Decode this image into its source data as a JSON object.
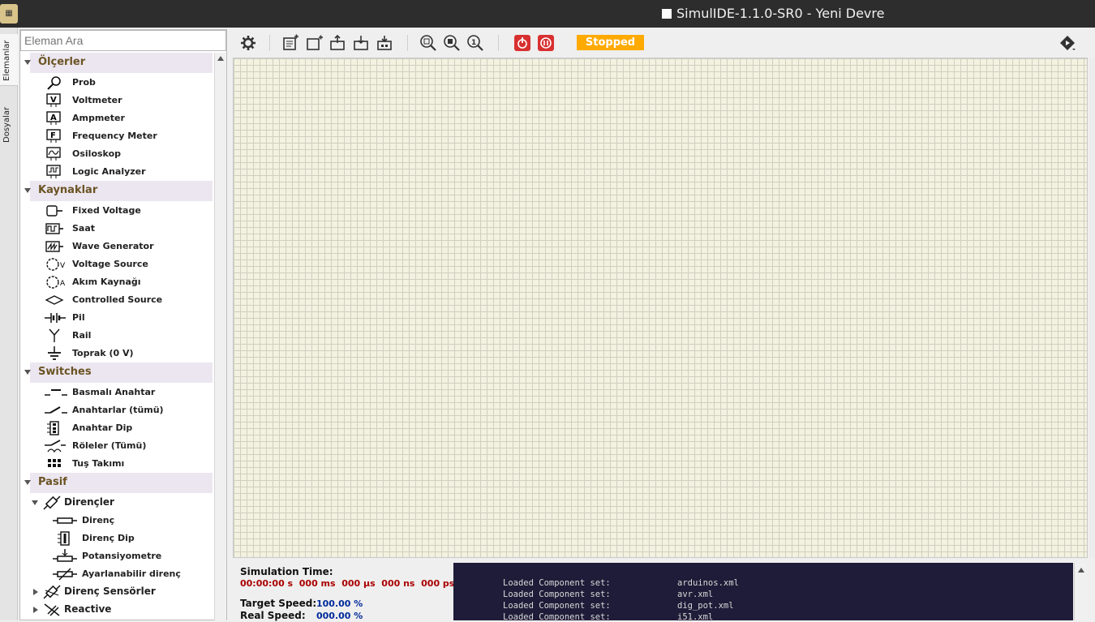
{
  "window": {
    "title": "SimulIDE-1.1.0-SR0 - Yeni Devre"
  },
  "side_tabs": {
    "components": "Elemanlar",
    "files": "Dosyalar"
  },
  "search": {
    "placeholder": "Eleman Ara"
  },
  "tree": {
    "categories": [
      {
        "label": "Ölçerler",
        "items": [
          "Prob",
          "Voltmeter",
          "Ampmeter",
          "Frequency Meter",
          "Osiloskop",
          "Logic Analyzer"
        ]
      },
      {
        "label": "Kaynaklar",
        "items": [
          "Fixed Voltage",
          "Saat",
          "Wave Generator",
          "Voltage Source",
          "Akım Kaynağı",
          "Controlled Source",
          "Pil",
          "Rail",
          "Toprak (0 V)"
        ]
      },
      {
        "label": "Switches",
        "items": [
          "Basmalı Anahtar",
          "Anahtarlar (tümü)",
          "Anahtar Dip",
          "Röleler (Tümü)",
          "Tuş Takımı"
        ]
      },
      {
        "label": "Pasif"
      }
    ],
    "pasif_groups": [
      {
        "label": "Dirençler",
        "expanded": true,
        "items": [
          "Direnç",
          "Direnç Dip",
          "Potansiyometre",
          "Ayarlanabilir direnç"
        ]
      },
      {
        "label": "Direnç Sensörler",
        "expanded": false
      },
      {
        "label": "Reactive",
        "expanded": false
      }
    ]
  },
  "toolbar": {
    "icons": [
      "gear-icon",
      "new-circuit-icon",
      "add-file-icon",
      "open-icon",
      "save-icon",
      "save-as-icon",
      "zoom-fit-icon",
      "zoom-selected-icon",
      "zoom-one-icon",
      "power-icon",
      "pause-icon",
      "debug-icon"
    ],
    "status": "Stopped",
    "status_color": "#ffaa00"
  },
  "simulation": {
    "time_label": "Simulation Time:",
    "time_value": "00:00:00 s  000 ms  000 µs  000 ns  000 ps",
    "target_label": "Target Speed:",
    "target_value": "100.00 %",
    "real_label": "Real Speed:",
    "real_value": "000.00 %"
  },
  "log": {
    "lines": [
      {
        "msg": "Loaded Component set:",
        "file": "arduinos.xml"
      },
      {
        "msg": "Loaded Component set:",
        "file": "avr.xml"
      },
      {
        "msg": "Loaded Component set:",
        "file": "dig_pot.xml"
      },
      {
        "msg": "Loaded Component set:",
        "file": "i51.xml"
      }
    ]
  }
}
